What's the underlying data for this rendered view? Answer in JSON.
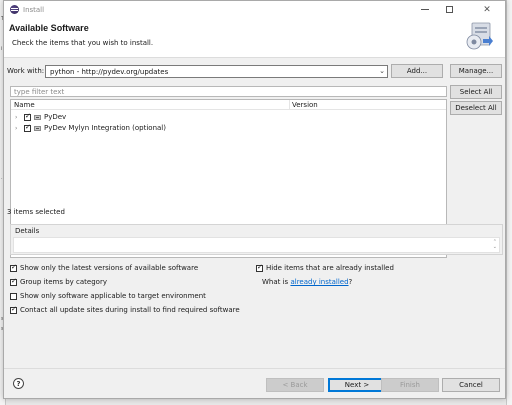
{
  "window": {
    "title": "Install"
  },
  "banner": {
    "title": "Available Software",
    "subtitle": "Check the items that you wish to install."
  },
  "work_with": {
    "label": "Work with:",
    "value": "python - http://pydev.org/updates",
    "add_button": "Add...",
    "manage_button": "Manage..."
  },
  "filter": {
    "placeholder": "type filter text"
  },
  "tree": {
    "columns": [
      "Name",
      "Version"
    ],
    "items": [
      {
        "label": "PyDev",
        "checked": true
      },
      {
        "label": "PyDev Mylyn Integration (optional)",
        "checked": true
      }
    ]
  },
  "selection": {
    "select_all": "Select All",
    "deselect_all": "Deselect All",
    "status": "3 items selected"
  },
  "details": {
    "label": "Details"
  },
  "options": {
    "latest_versions": "Show only the latest versions of available software",
    "group_by_category": "Group items by category",
    "target_environment": "Show only software applicable to target environment",
    "contact_sites": "Contact all update sites during install to find required software",
    "hide_installed": "Hide items that are already installed",
    "what_is_prefix": "What is",
    "already_installed_link": "already installed",
    "what_is_suffix": "?"
  },
  "footer": {
    "help": "?",
    "back": "< Back",
    "next": "Next >",
    "finish": "Finish",
    "cancel": "Cancel"
  },
  "colors": {
    "accent": "#0078d7",
    "link": "#0066cc"
  }
}
